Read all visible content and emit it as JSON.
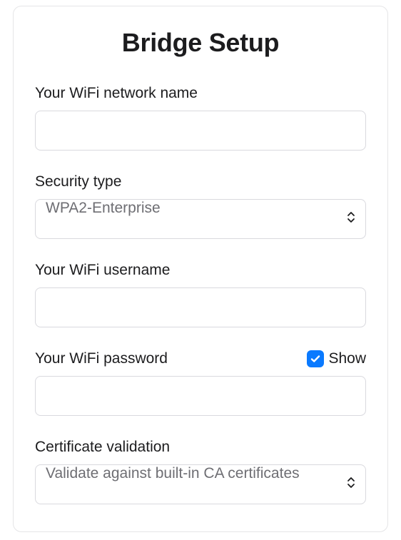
{
  "title": "Bridge Setup",
  "fields": {
    "wifi_name": {
      "label": "Your WiFi network name",
      "value": ""
    },
    "security_type": {
      "label": "Security type",
      "value": "WPA2-Enterprise"
    },
    "wifi_username": {
      "label": "Your WiFi username",
      "value": ""
    },
    "wifi_password": {
      "label": "Your WiFi password",
      "value": "",
      "show_label": "Show",
      "show_checked": true
    },
    "certificate_validation": {
      "label": "Certificate validation",
      "value": "Validate against built-in CA certificates"
    }
  }
}
